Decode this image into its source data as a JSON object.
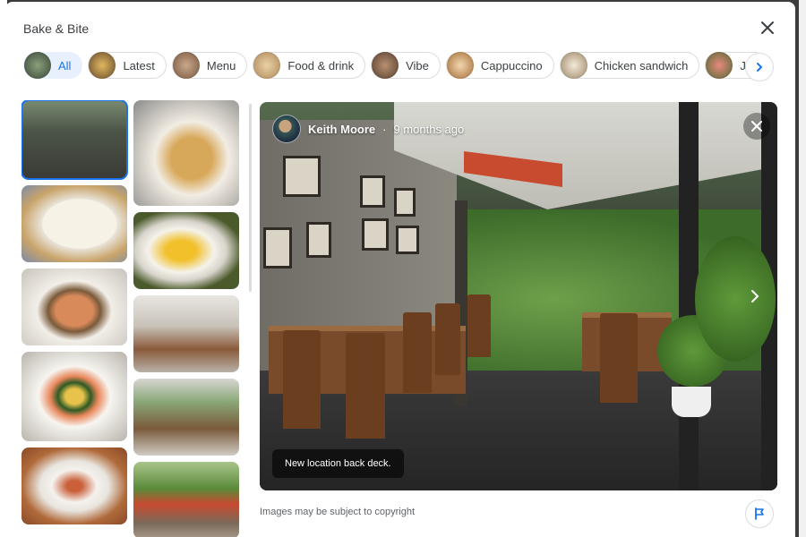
{
  "place_title": "Bake & Bite",
  "chips": [
    {
      "label": "All",
      "active": true,
      "color": "#556b5a"
    },
    {
      "label": "Latest",
      "active": false,
      "color": "#6b4f2e"
    },
    {
      "label": "Menu",
      "active": false,
      "color": "#7a5a44"
    },
    {
      "label": "Food & drink",
      "active": false,
      "color": "#b08a5a"
    },
    {
      "label": "Vibe",
      "active": false,
      "color": "#8a6a52"
    },
    {
      "label": "Cappuccino",
      "active": false,
      "color": "#c7955f"
    },
    {
      "label": "Chicken sandwich",
      "active": false,
      "color": "#c9b48f"
    },
    {
      "label": "Juice",
      "active": false,
      "color": "#b35a58"
    }
  ],
  "viewer": {
    "author": "Keith Moore",
    "time_ago": "9 months ago",
    "caption": "New location back deck."
  },
  "footer": {
    "copyright_note": "Images may be subject to copyright"
  },
  "colors": {
    "accent": "#1a73e8",
    "chip_active_bg": "#e8f0fe",
    "border": "#dadce0"
  },
  "icons": [
    "close-icon",
    "chevron-right-icon",
    "flag-icon"
  ]
}
